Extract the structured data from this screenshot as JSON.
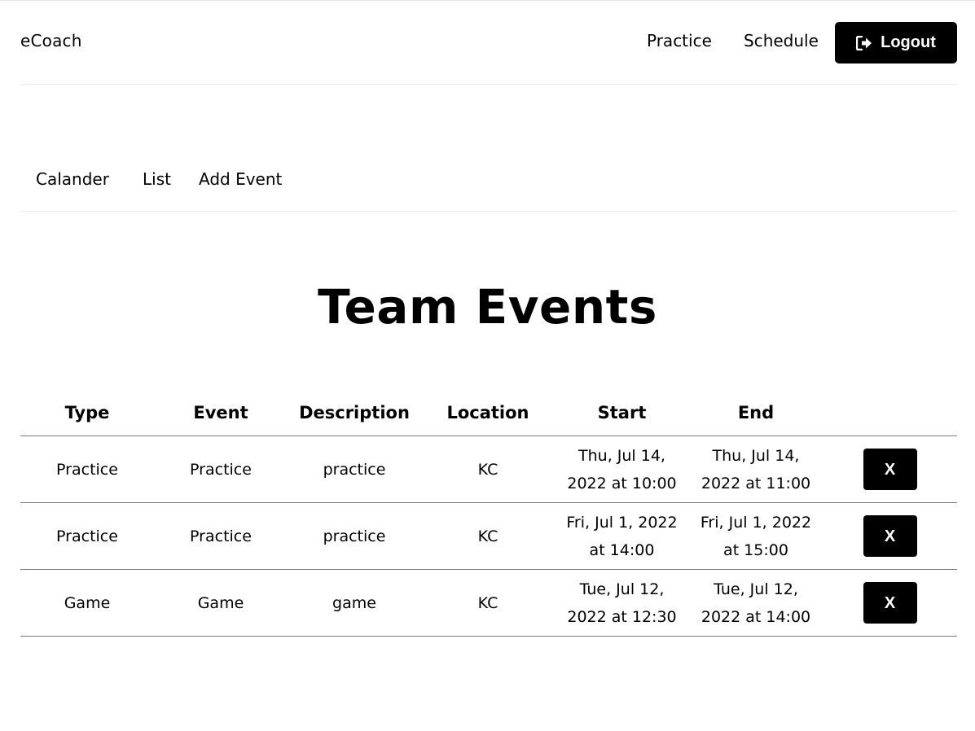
{
  "header": {
    "brand": "eCoach",
    "nav": {
      "practice": "Practice",
      "schedule": "Schedule"
    },
    "logout_label": "Logout",
    "logout_icon": "sign-out-icon"
  },
  "subnav": {
    "calendar": "Calander",
    "list": "List",
    "add_event": "Add Event"
  },
  "title": "Team Events",
  "table": {
    "headers": {
      "type": "Type",
      "event": "Event",
      "description": "Description",
      "location": "Location",
      "start": "Start",
      "end": "End"
    },
    "rows": [
      {
        "type": "Practice",
        "event": "Practice",
        "description": "practice",
        "location": "KC",
        "start": [
          "Thu, Jul 14,",
          "2022 at 10:00"
        ],
        "end": [
          "Thu, Jul 14,",
          "2022 at 11:00"
        ],
        "action": "X"
      },
      {
        "type": "Practice",
        "event": "Practice",
        "description": "practice",
        "location": "KC",
        "start": [
          "Fri, Jul 1, 2022",
          "at 14:00"
        ],
        "end": [
          "Fri, Jul 1, 2022",
          "at 15:00"
        ],
        "action": "X"
      },
      {
        "type": "Game",
        "event": "Game",
        "description": "game",
        "location": "KC",
        "start": [
          "Tue, Jul 12,",
          "2022 at 12:30"
        ],
        "end": [
          "Tue, Jul 12,",
          "2022 at 14:00"
        ],
        "action": "X"
      }
    ]
  },
  "colors": {
    "button_bg": "#000000",
    "button_text": "#ffffff",
    "divider": "#777777"
  }
}
